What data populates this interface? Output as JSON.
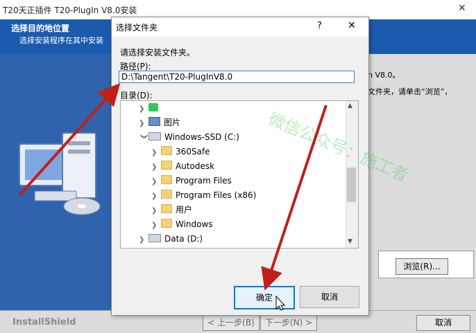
{
  "installer": {
    "title": "T20天正插件 T20-PlugIn V8.0安装",
    "header_title": "选择目的地位置",
    "header_subtitle": "选择安装程序在其中安装",
    "body_line1": "n V8.0。",
    "body_line2": "文件夹，请单击“浏览”，",
    "browse_button": "浏览(R)...",
    "brand": "InstallShield",
    "back_button": "< 上一步(B)",
    "next_button": "下一步(N) >",
    "cancel_button": "取消"
  },
  "dialog": {
    "title": "选择文件夹",
    "help": "?",
    "prompt": "请选择安装文件夹。",
    "path_label": "路径(P):",
    "path_value": "D:\\Tangent\\T20-PlugInV8.0",
    "dir_label": "目录(D):",
    "tree": [
      {
        "label": "",
        "icon": "app-icon",
        "expanded": false
      },
      {
        "label": "图片",
        "icon": "pictures-icon",
        "expanded": false
      },
      {
        "label": "Windows-SSD (C:)",
        "icon": "drive-icon",
        "expanded": true
      },
      {
        "label": "360Safe",
        "icon": "folder-icon",
        "expanded": false
      },
      {
        "label": "Autodesk",
        "icon": "folder-icon",
        "expanded": false
      },
      {
        "label": "Program Files",
        "icon": "folder-icon",
        "expanded": false
      },
      {
        "label": "Program Files (x86)",
        "icon": "folder-icon",
        "expanded": false
      },
      {
        "label": "用户",
        "icon": "folder-icon",
        "expanded": false
      },
      {
        "label": "Windows",
        "icon": "folder-icon",
        "expanded": false
      },
      {
        "label": "Data (D:)",
        "icon": "drive-icon",
        "expanded": false
      }
    ],
    "ok_button": "确定",
    "cancel_button": "取消"
  },
  "watermark": "微信公众号：施工者",
  "colors": {
    "header_blue": "#1a5bb0",
    "accent": "#0078d7",
    "arrow_red": "#c0201a"
  }
}
